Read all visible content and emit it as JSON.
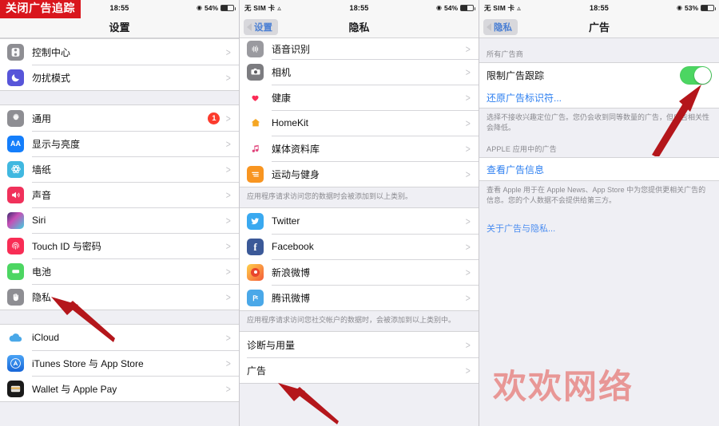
{
  "watermark": {
    "text": "欢欢网络",
    "color": "#e8908f"
  },
  "banner": {
    "text": "关闭广告追踪",
    "bg": "#d9161d",
    "fg": "#ffffff"
  },
  "panels": [
    {
      "id": "settings",
      "status": {
        "carrier": "",
        "wifi": "",
        "time": "18:55",
        "battery": "54%",
        "battery_pct": 54
      },
      "nav": {
        "back": "",
        "title": "设置"
      },
      "groups": [
        {
          "type": "list",
          "rows": [
            {
              "icon": "control-center-icon",
              "label": "控制中心",
              "chevron": ">"
            },
            {
              "icon": "do-not-disturb-icon",
              "label": "勿扰模式",
              "chevron": ">"
            }
          ]
        },
        {
          "type": "gap"
        },
        {
          "type": "list",
          "rows": [
            {
              "icon": "general-gear-icon",
              "label": "通用",
              "badge": "1",
              "chevron": ">"
            },
            {
              "icon": "display-brightness-icon",
              "label": "显示与亮度",
              "chevron": ">"
            },
            {
              "icon": "wallpaper-icon",
              "label": "墙纸",
              "chevron": ">"
            },
            {
              "icon": "sound-icon",
              "label": "声音",
              "chevron": ">"
            },
            {
              "icon": "siri-icon",
              "label": "Siri",
              "chevron": ">"
            },
            {
              "icon": "touch-id-icon",
              "label": "Touch ID 与密码",
              "chevron": ">"
            },
            {
              "icon": "battery-icon",
              "label": "电池",
              "chevron": ">"
            },
            {
              "icon": "privacy-hand-icon",
              "label": "隐私",
              "chevron": ">"
            }
          ]
        },
        {
          "type": "gap"
        },
        {
          "type": "list",
          "rows": [
            {
              "icon": "icloud-icon",
              "label": "iCloud",
              "chevron": ">"
            },
            {
              "icon": "itunes-appstore-icon",
              "label": "iTunes Store 与 App Store",
              "chevron": ">"
            },
            {
              "icon": "wallet-applepay-icon",
              "label": "Wallet 与 Apple Pay",
              "chevron": ">"
            }
          ]
        }
      ]
    },
    {
      "id": "privacy",
      "status": {
        "carrier": "无 SIM 卡",
        "wifi": "",
        "time": "18:55",
        "battery": "54%",
        "battery_pct": 54
      },
      "nav": {
        "back": "设置",
        "title": "隐私"
      },
      "groups": [
        {
          "type": "list",
          "rows": [
            {
              "icon": "speech-recognition-icon",
              "label": "语音识别",
              "chevron": ">"
            },
            {
              "icon": "camera-icon",
              "label": "相机",
              "chevron": ">"
            },
            {
              "icon": "health-icon",
              "label": "健康",
              "chevron": ">"
            },
            {
              "icon": "homekit-icon",
              "label": "HomeKit",
              "chevron": ">"
            },
            {
              "icon": "media-library-icon",
              "label": "媒体资料库",
              "chevron": ">"
            },
            {
              "icon": "motion-fitness-icon",
              "label": "运动与健身",
              "chevron": ">"
            }
          ]
        },
        {
          "type": "footnote",
          "text": "应用程序请求访问您的数据时会被添加到以上类别。"
        },
        {
          "type": "list",
          "rows": [
            {
              "icon": "twitter-icon",
              "label": "Twitter",
              "chevron": ">"
            },
            {
              "icon": "facebook-icon",
              "label": "Facebook",
              "chevron": ">"
            },
            {
              "icon": "sina-weibo-icon",
              "label": "新浪微博",
              "chevron": ">"
            },
            {
              "icon": "tencent-weibo-icon",
              "label": "腾讯微博",
              "chevron": ">"
            }
          ]
        },
        {
          "type": "footnote",
          "text": "应用程序请求访问您社交帐户的数据时，会被添加到以上类别中。"
        },
        {
          "type": "list-plain",
          "rows": [
            {
              "label": "诊断与用量",
              "chevron": ">"
            },
            {
              "label": "广告",
              "chevron": ">"
            }
          ]
        }
      ]
    },
    {
      "id": "advertising",
      "status": {
        "carrier": "无 SIM 卡",
        "wifi": "",
        "time": "18:55",
        "battery": "53%",
        "battery_pct": 53
      },
      "nav": {
        "back": "隐私",
        "title": "广告"
      },
      "section_header": "所有广告商",
      "toggle_row": {
        "label": "限制广告跟踪",
        "state": "on",
        "color": "#4cd662"
      },
      "reset_link": "还原广告标识符...",
      "footnote_1": "选择不接收兴趣定位广告。您仍会收到同等数量的广告，但广告相关性会降低。",
      "section_header_2": "APPLE 应用中的广告",
      "view_ad_link": "查看广告信息",
      "footnote_2": "查看 Apple 用于在 Apple News、App Store 中为您提供更相关广告的信息。您的个人数据不会提供给第三方。",
      "about_link": "关于广告与隐私..."
    }
  ]
}
